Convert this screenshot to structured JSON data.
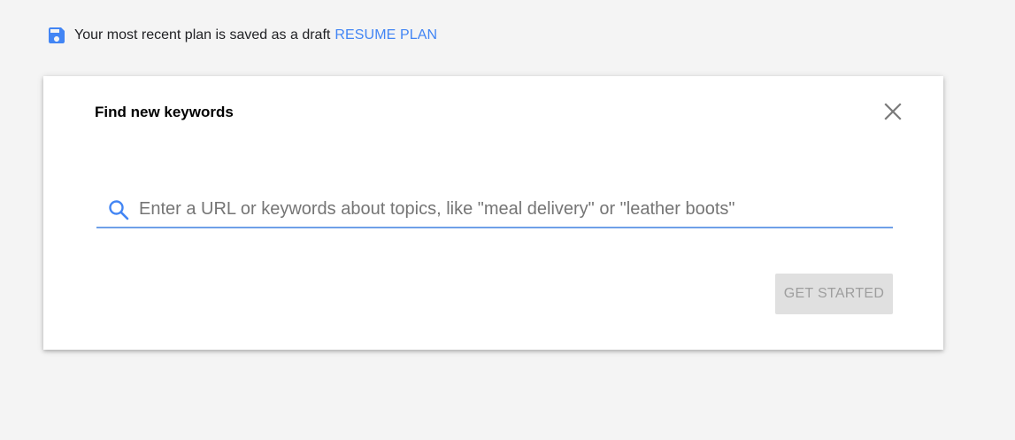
{
  "banner": {
    "text": "Your most recent plan is saved as a draft",
    "resume_label": "RESUME PLAN",
    "icon": "save-icon"
  },
  "dialog": {
    "title": "Find new keywords",
    "close_icon": "close-icon",
    "search": {
      "icon": "search-icon",
      "value": "",
      "placeholder": "Enter a URL or keywords about topics, like \"meal delivery\" or \"leather boots\""
    },
    "submit_label": "GET STARTED",
    "submit_disabled": true
  },
  "colors": {
    "accent": "#4285f4",
    "underline": "#6fa0e8",
    "disabled_bg": "#e0e0e0",
    "disabled_text": "#9e9e9e",
    "page_bg": "#f4f4f4"
  }
}
